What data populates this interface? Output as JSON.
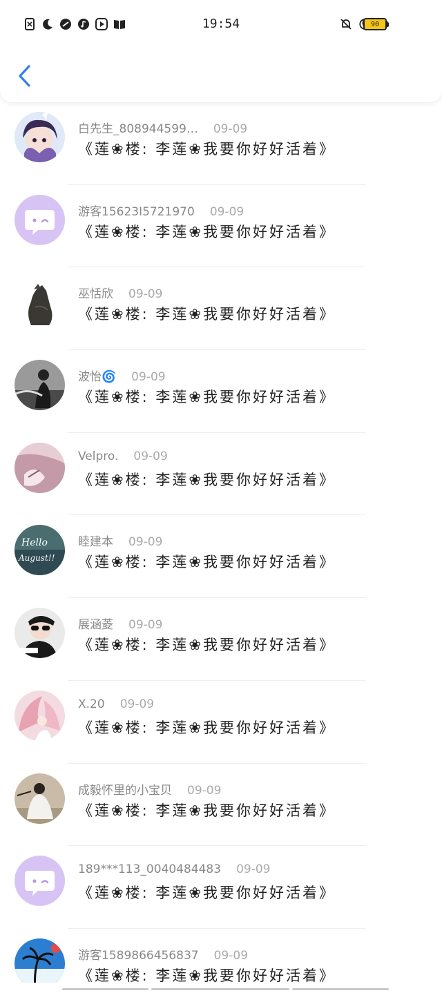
{
  "status_bar": {
    "time": "19:54",
    "battery": "90",
    "left_icons": [
      "sim-off-icon",
      "moon-icon",
      "link-icon",
      "music-icon",
      "play-icon",
      "book-icon"
    ],
    "right_icons": [
      "bell-off-icon",
      "moon-icon",
      "wifi-icon"
    ]
  },
  "comments": [
    {
      "name": "白先生_808944599…",
      "date": "09-09",
      "text": "《莲❀楼: 李莲❀我要你好好活着》",
      "avatar": "anime-girl"
    },
    {
      "name": "游客15623I5721970",
      "date": "09-09",
      "text": "《莲❀楼: 李莲❀我要你好好活着》",
      "avatar": "default-chat"
    },
    {
      "name": "巫恬欣",
      "date": "09-09",
      "text": "《莲❀楼: 李莲❀我要你好好活着》",
      "avatar": "bird-statue"
    },
    {
      "name": "波怡🌀",
      "date": "09-09",
      "text": "《莲❀楼: 李莲❀我要你好好活着》",
      "avatar": "bw-person"
    },
    {
      "name": "Velpro.",
      "date": "09-09",
      "text": "《莲❀楼: 李莲❀我要你好好活着》",
      "avatar": "pink-anime"
    },
    {
      "name": "睦建本",
      "date": "09-09",
      "text": "《莲❀楼: 李莲❀我要你好好活着》",
      "avatar": "hello-august"
    },
    {
      "name": "展涵菱",
      "date": "09-09",
      "text": "《莲❀楼: 李莲❀我要你好好活着》",
      "avatar": "sunglasses"
    },
    {
      "name": "X.20",
      "date": "09-09",
      "text": "《莲❀楼: 李莲❀我要你好好活着》",
      "avatar": "pink-wings"
    },
    {
      "name": "成毅怀里的小宝贝",
      "date": "09-09",
      "text": "《莲❀楼: 李莲❀我要你好好活着》",
      "avatar": "white-robe"
    },
    {
      "name": "189***113_0040484483",
      "date": "09-09",
      "text": "《莲❀楼: 李莲❀我要你好好活着》",
      "avatar": "default-chat"
    },
    {
      "name": "游客1589866456837",
      "date": "09-09",
      "text": "《莲❀楼: 李莲❀我要你好好活着》",
      "avatar": "palm-tree"
    }
  ],
  "colors": {
    "accent": "#2f80ed",
    "default_avatar": "#d7c4f4"
  }
}
